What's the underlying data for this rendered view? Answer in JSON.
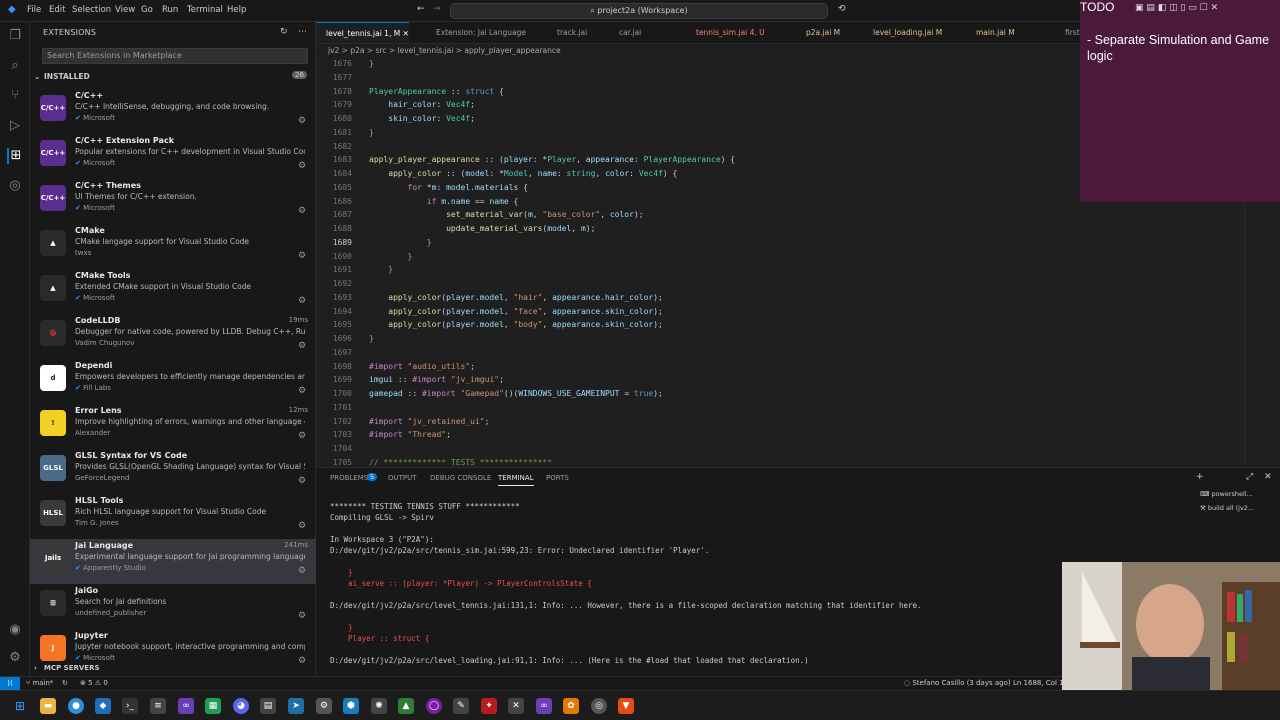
{
  "titlebar": {
    "menu": [
      "File",
      "Edit",
      "Selection",
      "View",
      "Go",
      "Run",
      "Terminal",
      "Help"
    ],
    "command_center": "project2a (Workspace)"
  },
  "sidebar": {
    "title": "EXTENSIONS",
    "search_placeholder": "Search Extensions in Marketplace",
    "installed_label": "INSTALLED",
    "installed_count": "26",
    "extensions": [
      {
        "name": "C/C++",
        "desc": "C/C++ IntelliSense, debugging, and code browsing.",
        "publisher": "Microsoft",
        "verified": true,
        "time": "",
        "logo": "C/C++",
        "color": "#5c2d91"
      },
      {
        "name": "C/C++ Extension Pack",
        "desc": "Popular extensions for C++ development in Visual Studio Code.",
        "publisher": "Microsoft",
        "verified": true,
        "time": "",
        "logo": "C/C++",
        "color": "#5c2d91"
      },
      {
        "name": "C/C++ Themes",
        "desc": "UI Themes for C/C++ extension.",
        "publisher": "Microsoft",
        "verified": true,
        "time": "",
        "logo": "C/C++",
        "color": "#5c2d91"
      },
      {
        "name": "CMake",
        "desc": "CMake langage support for Visual Studio Code",
        "publisher": "twxs",
        "verified": false,
        "time": "",
        "logo": "▲",
        "color": "#2a2a2a"
      },
      {
        "name": "CMake Tools",
        "desc": "Extended CMake support in Visual Studio Code",
        "publisher": "Microsoft",
        "verified": true,
        "time": "",
        "logo": "▲",
        "color": "#2a2a2a"
      },
      {
        "name": "CodeLLDB",
        "desc": "Debugger for native code, powered by LLDB. Debug C++, Rust,...",
        "publisher": "Vadim Chugunov",
        "verified": false,
        "time": "19ms",
        "logo": "🐞",
        "color": "#2a2a2a"
      },
      {
        "name": "Dependi",
        "desc": "Empowers developers to efficiently manage dependencies and ...",
        "publisher": "Fill Labs",
        "verified": true,
        "time": "",
        "logo": "d",
        "color": "#ffffff"
      },
      {
        "name": "Error Lens",
        "desc": "Improve highlighting of errors, warnings and other language di...",
        "publisher": "Alexander",
        "verified": false,
        "time": "12ms",
        "logo": "!",
        "color": "#f2d024"
      },
      {
        "name": "GLSL Syntax for VS Code",
        "desc": "Provides GLSL(OpenGL Shading Language) syntax for Visual Stu...",
        "publisher": "GeForceLegend",
        "verified": false,
        "time": "",
        "logo": "GLSL",
        "color": "#4a6a8a"
      },
      {
        "name": "HLSL Tools",
        "desc": "Rich HLSL language support for Visual Studio Code",
        "publisher": "Tim G. Jones",
        "verified": false,
        "time": "",
        "logo": "HLSL",
        "color": "#3a3a3a"
      },
      {
        "name": "Jai Language",
        "desc": "Experimental language support for Jai programming language (...",
        "publisher": "Apparently Studio",
        "verified": true,
        "time": "241ms",
        "logo": "Jails",
        "color": "#3a3a3a"
      },
      {
        "name": "JaiGo",
        "desc": "Search for Jai definitions",
        "publisher": "undefined_publisher",
        "verified": false,
        "time": "",
        "logo": "⊞",
        "color": "#2a2a2a"
      },
      {
        "name": "Jupyter",
        "desc": "Jupyter notebook support, interactive programming and comp...",
        "publisher": "Microsoft",
        "verified": true,
        "time": "",
        "logo": "J",
        "color": "#f37626"
      }
    ],
    "mcp_label": "MCP SERVERS"
  },
  "tabs": [
    {
      "label": "level_tennis.jai 1, M",
      "state": "active"
    },
    {
      "label": "Extension: Jai Language",
      "state": ""
    },
    {
      "label": "track.jai",
      "state": ""
    },
    {
      "label": "car.jai",
      "state": ""
    },
    {
      "label": "tennis_sim.jai 4, U",
      "state": "err"
    },
    {
      "label": "p2a.jai M",
      "state": "mod"
    },
    {
      "label": "level_loading.jai M",
      "state": "mod"
    },
    {
      "label": "main.jai M",
      "state": "mod"
    },
    {
      "label": "first.j",
      "state": ""
    }
  ],
  "breadcrumb": "jv2 > p2a > src > level_tennis.jai > apply_player_appearance",
  "code": [
    {
      "n": "1676",
      "segs": [
        [
          "p",
          "}"
        ]
      ]
    },
    {
      "n": "1677",
      "segs": []
    },
    {
      "n": "1678",
      "segs": [
        [
          "t",
          "PlayerAppearance"
        ],
        [
          "",
          " :: "
        ],
        [
          "k",
          "struct"
        ],
        [
          "",
          " {"
        ]
      ]
    },
    {
      "n": "1679",
      "segs": [
        [
          "",
          "    "
        ],
        [
          "v",
          "hair_color"
        ],
        [
          "",
          ": "
        ],
        [
          "t",
          "Vec4f"
        ],
        [
          "",
          ";"
        ]
      ]
    },
    {
      "n": "1680",
      "segs": [
        [
          "",
          "    "
        ],
        [
          "v",
          "skin_color"
        ],
        [
          "",
          ": "
        ],
        [
          "t",
          "Vec4f"
        ],
        [
          "",
          ";"
        ]
      ]
    },
    {
      "n": "1681",
      "segs": [
        [
          "p",
          "}"
        ]
      ]
    },
    {
      "n": "1682",
      "segs": []
    },
    {
      "n": "1683",
      "segs": [
        [
          "f",
          "apply_player_appearance"
        ],
        [
          "",
          " :: ("
        ],
        [
          "v",
          "player"
        ],
        [
          "",
          ": *"
        ],
        [
          "t",
          "Player"
        ],
        [
          "",
          ", "
        ],
        [
          "v",
          "appearance"
        ],
        [
          "",
          ": "
        ],
        [
          "t",
          "PlayerAppearance"
        ],
        [
          "",
          ") {"
        ]
      ]
    },
    {
      "n": "1684",
      "segs": [
        [
          "",
          "    "
        ],
        [
          "f",
          "apply_color"
        ],
        [
          "",
          " :: ("
        ],
        [
          "v",
          "model"
        ],
        [
          "",
          ": *"
        ],
        [
          "t",
          "Model"
        ],
        [
          "",
          ", "
        ],
        [
          "v",
          "name"
        ],
        [
          "",
          ": "
        ],
        [
          "t",
          "string"
        ],
        [
          "",
          ", "
        ],
        [
          "v",
          "color"
        ],
        [
          "",
          ": "
        ],
        [
          "t",
          "Vec4f"
        ],
        [
          "",
          ") {"
        ]
      ]
    },
    {
      "n": "1685",
      "segs": [
        [
          "",
          "        "
        ],
        [
          "p",
          "for"
        ],
        [
          "",
          " *"
        ],
        [
          "v",
          "m"
        ],
        [
          "",
          ": "
        ],
        [
          "v",
          "model.materials"
        ],
        [
          "",
          " {"
        ]
      ]
    },
    {
      "n": "1686",
      "segs": [
        [
          "",
          "            "
        ],
        [
          "p",
          "if"
        ],
        [
          "",
          " "
        ],
        [
          "v",
          "m.name"
        ],
        [
          "",
          " == "
        ],
        [
          "v",
          "name"
        ],
        [
          "",
          " {"
        ]
      ]
    },
    {
      "n": "1687",
      "segs": [
        [
          "",
          "                "
        ],
        [
          "f",
          "set_material_var"
        ],
        [
          "",
          "("
        ],
        [
          "v",
          "m"
        ],
        [
          "",
          ", "
        ],
        [
          "s",
          "\"base_color\""
        ],
        [
          "",
          ", "
        ],
        [
          "v",
          "color"
        ],
        [
          "",
          ");"
        ]
      ]
    },
    {
      "n": "1688",
      "segs": [
        [
          "",
          "                "
        ],
        [
          "f",
          "update_material_vars"
        ],
        [
          "",
          "("
        ],
        [
          "v",
          "model"
        ],
        [
          "",
          ", "
        ],
        [
          "v",
          "m"
        ],
        [
          "",
          ");"
        ]
      ]
    },
    {
      "n": "1689",
      "segs": [
        [
          "",
          "            "
        ],
        [
          "p",
          "}"
        ]
      ],
      "cur": true
    },
    {
      "n": "1690",
      "segs": [
        [
          "",
          "        "
        ],
        [
          "p",
          "}"
        ]
      ]
    },
    {
      "n": "1691",
      "segs": [
        [
          "",
          "    "
        ],
        [
          "p",
          "}"
        ]
      ]
    },
    {
      "n": "1692",
      "segs": []
    },
    {
      "n": "1693",
      "segs": [
        [
          "",
          "    "
        ],
        [
          "f",
          "apply_color"
        ],
        [
          "",
          "("
        ],
        [
          "v",
          "player.model"
        ],
        [
          "",
          ", "
        ],
        [
          "s",
          "\"hair\""
        ],
        [
          "",
          ", "
        ],
        [
          "v",
          "appearance.hair_color"
        ],
        [
          "",
          ");"
        ]
      ]
    },
    {
      "n": "1694",
      "segs": [
        [
          "",
          "    "
        ],
        [
          "f",
          "apply_color"
        ],
        [
          "",
          "("
        ],
        [
          "v",
          "player.model"
        ],
        [
          "",
          ", "
        ],
        [
          "s",
          "\"face\""
        ],
        [
          "",
          ", "
        ],
        [
          "v",
          "appearance.skin_color"
        ],
        [
          "",
          ");"
        ]
      ]
    },
    {
      "n": "1695",
      "segs": [
        [
          "",
          "    "
        ],
        [
          "f",
          "apply_color"
        ],
        [
          "",
          "("
        ],
        [
          "v",
          "player.model"
        ],
        [
          "",
          ", "
        ],
        [
          "s",
          "\"body\""
        ],
        [
          "",
          ", "
        ],
        [
          "v",
          "appearance.skin_color"
        ],
        [
          "",
          ");"
        ]
      ]
    },
    {
      "n": "1696",
      "segs": [
        [
          "p",
          "}"
        ]
      ]
    },
    {
      "n": "1697",
      "segs": []
    },
    {
      "n": "1698",
      "segs": [
        [
          "p",
          "#import"
        ],
        [
          "",
          " "
        ],
        [
          "s",
          "\"audio_utils\""
        ],
        [
          "",
          ";"
        ]
      ]
    },
    {
      "n": "1699",
      "segs": [
        [
          "v",
          "imgui"
        ],
        [
          "",
          " :: "
        ],
        [
          "p",
          "#import"
        ],
        [
          "",
          " "
        ],
        [
          "s",
          "\"jv_imgui\""
        ],
        [
          "",
          ";"
        ]
      ]
    },
    {
      "n": "1700",
      "segs": [
        [
          "v",
          "gamepad"
        ],
        [
          "",
          " :: "
        ],
        [
          "p",
          "#import"
        ],
        [
          "",
          " "
        ],
        [
          "s",
          "\"Gamepad\""
        ],
        [
          "",
          "()("
        ],
        [
          "v",
          "WINDOWS_USE_GAMEINPUT"
        ],
        [
          "",
          " = "
        ],
        [
          "k",
          "true"
        ],
        [
          "",
          ");"
        ]
      ]
    },
    {
      "n": "1701",
      "segs": []
    },
    {
      "n": "1702",
      "segs": [
        [
          "p",
          "#import"
        ],
        [
          "",
          " "
        ],
        [
          "s",
          "\"jv_retained_ui\""
        ],
        [
          "",
          ";"
        ]
      ]
    },
    {
      "n": "1703",
      "segs": [
        [
          "p",
          "#import"
        ],
        [
          "",
          " "
        ],
        [
          "s",
          "\"Thread\""
        ],
        [
          "",
          ";"
        ]
      ]
    },
    {
      "n": "1704",
      "segs": []
    },
    {
      "n": "1705",
      "segs": [
        [
          "c",
          "// ************* TESTS ***************"
        ]
      ]
    }
  ],
  "panel": {
    "tabs": [
      "PROBLEMS",
      "OUTPUT",
      "DEBUG CONSOLE",
      "TERMINAL",
      "PORTS"
    ],
    "problems_count": "5",
    "terminal_name": "powershell...",
    "terminal_name2": "build all (jv2...",
    "terminal": [
      {
        "text": "******** TESTING TENNIS STUFF ************",
        "red": false
      },
      {
        "text": "Compiling GLSL -> Spirv",
        "red": false
      },
      {
        "text": "",
        "red": false
      },
      {
        "text": "In Workspace 3 (\"P2A\"):",
        "red": false
      },
      {
        "text": "D:/dev/git/jv2/p2a/src/tennis_sim.jai:599,23: Error: Undeclared identifier 'Player'.",
        "red": false
      },
      {
        "text": "",
        "red": false
      },
      {
        "text": "    }",
        "red": true
      },
      {
        "text": "    ai_serve :: (player: *Player) -> PlayerControlsState {",
        "red": true
      },
      {
        "text": "",
        "red": false
      },
      {
        "text": "D:/dev/git/jv2/p2a/src/level_tennis.jai:131,1: Info: ... However, there is a file-scoped declaration matching that identifier here.",
        "red": false
      },
      {
        "text": "",
        "red": false
      },
      {
        "text": "    }",
        "red": true
      },
      {
        "text": "    Player :: struct {",
        "red": true
      },
      {
        "text": "",
        "red": false
      },
      {
        "text": "D:/dev/git/jv2/p2a/src/level_loading.jai:91,1: Info: ... (Here is the #load that loaded that declaration.)",
        "red": false
      }
    ]
  },
  "statusbar": {
    "branch": "main*",
    "errors": "5",
    "warnings": "0",
    "blame": "Stefano Casillo (3 days ago)",
    "cursor": "Ln 1688, Col 1"
  },
  "todo": {
    "title": "TODO",
    "item": "- Separate Simulation and Game logic"
  },
  "colors": {
    "accent": "#0078d4",
    "todo_bg": "#4b1a3a"
  }
}
